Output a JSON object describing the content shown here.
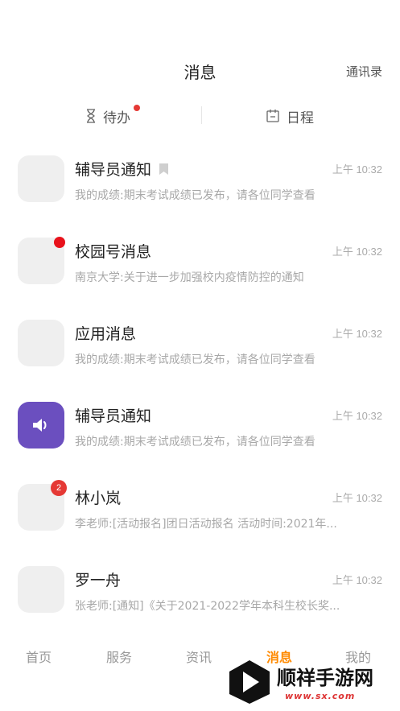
{
  "header": {
    "title": "消息",
    "contacts_label": "通讯录"
  },
  "tabs": {
    "todo": {
      "label": "待办",
      "icon": "hourglass-icon",
      "has_dot": true
    },
    "schedule": {
      "label": "日程",
      "icon": "calendar-icon"
    }
  },
  "messages": [
    {
      "name": "辅导员通知",
      "time": "上午 10:32",
      "preview": "我的成绩:期末考试成绩已发布，请各位同学查看",
      "flag": true
    },
    {
      "name": "校园号消息",
      "time": "上午 10:32",
      "preview": "南京大学:关于进一步加强校内疫情防控的通知",
      "unread_dot": true
    },
    {
      "name": "应用消息",
      "time": "上午 10:32",
      "preview": "我的成绩:期末考试成绩已发布，请各位同学查看"
    },
    {
      "name": "辅导员通知",
      "time": "上午 10:32",
      "preview": "我的成绩:期末考试成绩已发布，请各位同学查看",
      "avatar_icon": "speaker-icon",
      "avatar_color": "#6b4fbf"
    },
    {
      "name": "林小岚",
      "time": "上午 10:32",
      "preview": "李老师:[活动报名]团日活动报名 活动时间:2021年...",
      "badge": "2"
    },
    {
      "name": "罗一舟",
      "time": "上午 10:32",
      "preview": "张老师:[通知]《关于2021-2022学年本科生校长奖..."
    }
  ],
  "bottom_nav": {
    "items": [
      "首页",
      "服务",
      "资讯",
      "消息",
      "我的"
    ],
    "active": "消息"
  },
  "colors": {
    "accent": "#ff8a00",
    "unread": "#e8121b",
    "purple": "#6b4fbf"
  },
  "watermark": {
    "text": "顺祥手游网",
    "sub": "www.sx.com"
  }
}
